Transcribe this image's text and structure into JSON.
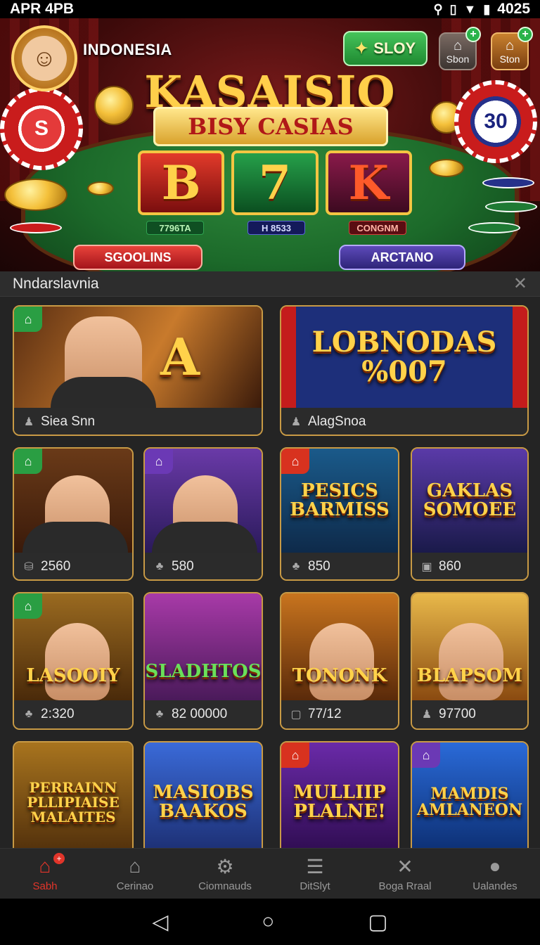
{
  "status_bar": {
    "time": "APR 4PB",
    "battery": "4025",
    "icons": [
      "key-icon",
      "vibrate-icon",
      "wifi-icon",
      "battery-icon"
    ]
  },
  "header": {
    "country": "INDONESIA",
    "sloy_label": "SLOY",
    "shop1_label": "Sbon",
    "shop2_label": "Ston"
  },
  "hero": {
    "logo": "KASAISIO",
    "ribbon": "BISY CASIAS",
    "reels": [
      "B",
      "7",
      "K"
    ],
    "jackpots": [
      "7796TA",
      "H 8533",
      "CONGNM"
    ],
    "chip_left": "S",
    "chip_right": "30",
    "left_button": "SGOOLINS",
    "right_button": "ARCTANO"
  },
  "section": {
    "title": "Nndarslavnia"
  },
  "featured": [
    {
      "label": "Siea Snn",
      "title": "A",
      "badge": "green"
    },
    {
      "label": "AlagSnoa",
      "title": "LOBNODAS\n%007",
      "badge": ""
    }
  ],
  "row1": [
    {
      "value": "2560",
      "title": "",
      "badge": "green"
    },
    {
      "value": "580",
      "title": "",
      "badge": "purple"
    },
    {
      "value": "850",
      "title": "PESICS\nBARMISS",
      "badge": "red"
    },
    {
      "value": "860",
      "title": "GAKLAS\nSOMOEE",
      "badge": ""
    }
  ],
  "row2": [
    {
      "value": "2:320",
      "title": "LASOOIY",
      "badge": "green"
    },
    {
      "value": "82 00000",
      "title": "SLADHTOS",
      "badge": ""
    },
    {
      "value": "77/12",
      "title": "TONONK",
      "badge": ""
    },
    {
      "value": "97700",
      "title": "BLAPSOM",
      "badge": ""
    }
  ],
  "row3": [
    {
      "title": "PERRAINN\nPLLIPIAISE\nMALAITES",
      "badge": ""
    },
    {
      "title": "MASIOBS\nBAAKOS",
      "badge": ""
    },
    {
      "title": "MULLIIP\nPLALNE!",
      "badge": "red"
    },
    {
      "title": "MAMDIS\nAMLANEON",
      "badge": "purple"
    }
  ],
  "bottom_nav": [
    "Sabh",
    "Cerinao",
    "Ciomnauds",
    "DitSlyt",
    "Boga Rraal",
    "Ualandes"
  ]
}
